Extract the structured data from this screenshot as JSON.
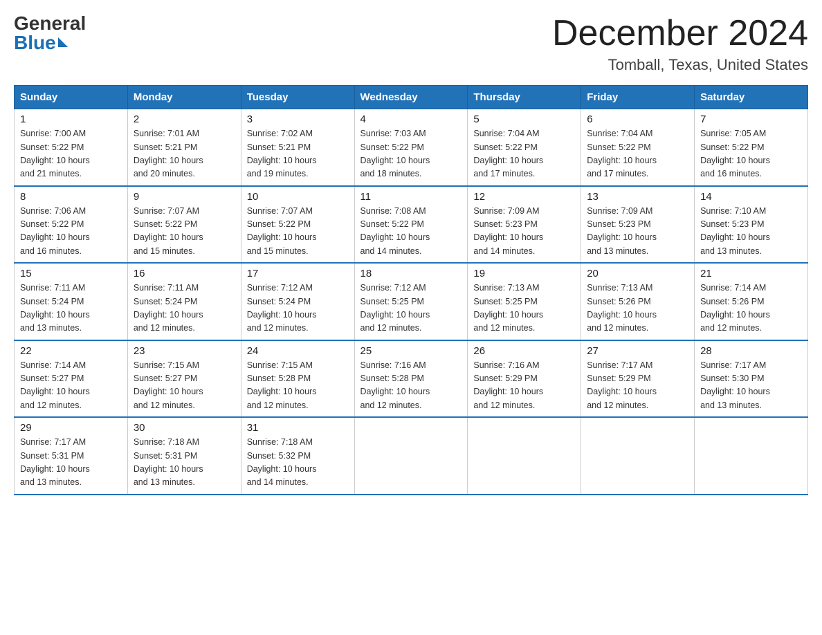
{
  "header": {
    "logo_general": "General",
    "logo_blue": "Blue",
    "month_title": "December 2024",
    "location": "Tomball, Texas, United States"
  },
  "days_of_week": [
    "Sunday",
    "Monday",
    "Tuesday",
    "Wednesday",
    "Thursday",
    "Friday",
    "Saturday"
  ],
  "weeks": [
    [
      {
        "day": "1",
        "sunrise": "7:00 AM",
        "sunset": "5:22 PM",
        "daylight": "10 hours and 21 minutes."
      },
      {
        "day": "2",
        "sunrise": "7:01 AM",
        "sunset": "5:21 PM",
        "daylight": "10 hours and 20 minutes."
      },
      {
        "day": "3",
        "sunrise": "7:02 AM",
        "sunset": "5:21 PM",
        "daylight": "10 hours and 19 minutes."
      },
      {
        "day": "4",
        "sunrise": "7:03 AM",
        "sunset": "5:22 PM",
        "daylight": "10 hours and 18 minutes."
      },
      {
        "day": "5",
        "sunrise": "7:04 AM",
        "sunset": "5:22 PM",
        "daylight": "10 hours and 17 minutes."
      },
      {
        "day": "6",
        "sunrise": "7:04 AM",
        "sunset": "5:22 PM",
        "daylight": "10 hours and 17 minutes."
      },
      {
        "day": "7",
        "sunrise": "7:05 AM",
        "sunset": "5:22 PM",
        "daylight": "10 hours and 16 minutes."
      }
    ],
    [
      {
        "day": "8",
        "sunrise": "7:06 AM",
        "sunset": "5:22 PM",
        "daylight": "10 hours and 16 minutes."
      },
      {
        "day": "9",
        "sunrise": "7:07 AM",
        "sunset": "5:22 PM",
        "daylight": "10 hours and 15 minutes."
      },
      {
        "day": "10",
        "sunrise": "7:07 AM",
        "sunset": "5:22 PM",
        "daylight": "10 hours and 15 minutes."
      },
      {
        "day": "11",
        "sunrise": "7:08 AM",
        "sunset": "5:22 PM",
        "daylight": "10 hours and 14 minutes."
      },
      {
        "day": "12",
        "sunrise": "7:09 AM",
        "sunset": "5:23 PM",
        "daylight": "10 hours and 14 minutes."
      },
      {
        "day": "13",
        "sunrise": "7:09 AM",
        "sunset": "5:23 PM",
        "daylight": "10 hours and 13 minutes."
      },
      {
        "day": "14",
        "sunrise": "7:10 AM",
        "sunset": "5:23 PM",
        "daylight": "10 hours and 13 minutes."
      }
    ],
    [
      {
        "day": "15",
        "sunrise": "7:11 AM",
        "sunset": "5:24 PM",
        "daylight": "10 hours and 13 minutes."
      },
      {
        "day": "16",
        "sunrise": "7:11 AM",
        "sunset": "5:24 PM",
        "daylight": "10 hours and 12 minutes."
      },
      {
        "day": "17",
        "sunrise": "7:12 AM",
        "sunset": "5:24 PM",
        "daylight": "10 hours and 12 minutes."
      },
      {
        "day": "18",
        "sunrise": "7:12 AM",
        "sunset": "5:25 PM",
        "daylight": "10 hours and 12 minutes."
      },
      {
        "day": "19",
        "sunrise": "7:13 AM",
        "sunset": "5:25 PM",
        "daylight": "10 hours and 12 minutes."
      },
      {
        "day": "20",
        "sunrise": "7:13 AM",
        "sunset": "5:26 PM",
        "daylight": "10 hours and 12 minutes."
      },
      {
        "day": "21",
        "sunrise": "7:14 AM",
        "sunset": "5:26 PM",
        "daylight": "10 hours and 12 minutes."
      }
    ],
    [
      {
        "day": "22",
        "sunrise": "7:14 AM",
        "sunset": "5:27 PM",
        "daylight": "10 hours and 12 minutes."
      },
      {
        "day": "23",
        "sunrise": "7:15 AM",
        "sunset": "5:27 PM",
        "daylight": "10 hours and 12 minutes."
      },
      {
        "day": "24",
        "sunrise": "7:15 AM",
        "sunset": "5:28 PM",
        "daylight": "10 hours and 12 minutes."
      },
      {
        "day": "25",
        "sunrise": "7:16 AM",
        "sunset": "5:28 PM",
        "daylight": "10 hours and 12 minutes."
      },
      {
        "day": "26",
        "sunrise": "7:16 AM",
        "sunset": "5:29 PM",
        "daylight": "10 hours and 12 minutes."
      },
      {
        "day": "27",
        "sunrise": "7:17 AM",
        "sunset": "5:29 PM",
        "daylight": "10 hours and 12 minutes."
      },
      {
        "day": "28",
        "sunrise": "7:17 AM",
        "sunset": "5:30 PM",
        "daylight": "10 hours and 13 minutes."
      }
    ],
    [
      {
        "day": "29",
        "sunrise": "7:17 AM",
        "sunset": "5:31 PM",
        "daylight": "10 hours and 13 minutes."
      },
      {
        "day": "30",
        "sunrise": "7:18 AM",
        "sunset": "5:31 PM",
        "daylight": "10 hours and 13 minutes."
      },
      {
        "day": "31",
        "sunrise": "7:18 AM",
        "sunset": "5:32 PM",
        "daylight": "10 hours and 14 minutes."
      },
      null,
      null,
      null,
      null
    ]
  ],
  "labels": {
    "sunrise": "Sunrise: ",
    "sunset": "Sunset: ",
    "daylight": "Daylight: "
  }
}
